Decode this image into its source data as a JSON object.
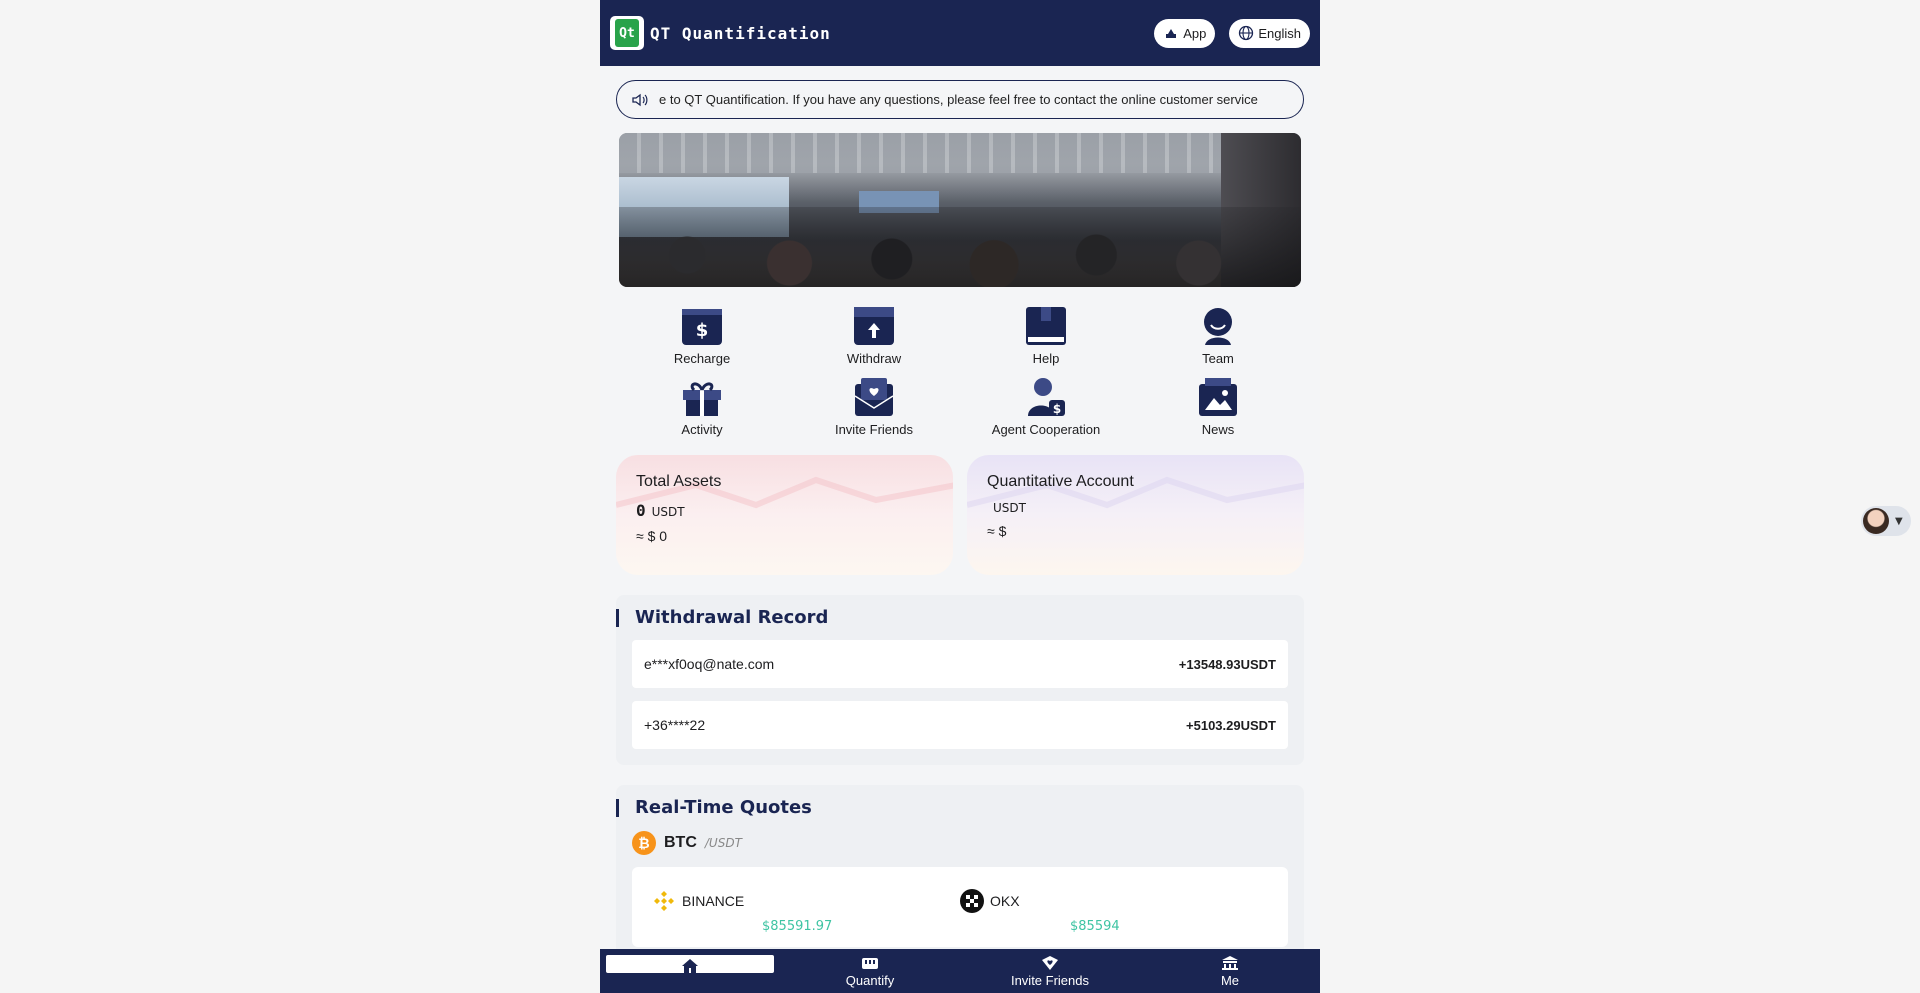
{
  "header": {
    "app_title": "QT Quantification",
    "logo_text": "Qt",
    "app_button": "App",
    "language_button": "English"
  },
  "notice": {
    "text": "e to QT Quantification. If you have any questions, please feel free to contact the online customer service"
  },
  "menu": {
    "items": [
      {
        "label": "Recharge",
        "icon": "recharge-icon"
      },
      {
        "label": "Withdraw",
        "icon": "withdraw-icon"
      },
      {
        "label": "Help",
        "icon": "help-book-icon"
      },
      {
        "label": "Team",
        "icon": "team-icon"
      },
      {
        "label": "Activity",
        "icon": "gift-icon"
      },
      {
        "label": "Invite Friends",
        "icon": "invite-icon"
      },
      {
        "label": "Agent Cooperation",
        "icon": "agent-icon"
      },
      {
        "label": "News",
        "icon": "news-icon"
      }
    ]
  },
  "assets": {
    "total": {
      "title": "Total Assets",
      "amount": "0",
      "unit": "USDT",
      "usd": "≈ $ 0"
    },
    "quant": {
      "title": "Quantitative Account",
      "amount": "",
      "unit": "USDT",
      "usd": "≈ $"
    }
  },
  "withdrawals": {
    "title": "Withdrawal Record",
    "rows": [
      {
        "user": "e***xf0oq@nate.com",
        "amount": "+13548.93USDT"
      },
      {
        "user": "+36****22",
        "amount": "+5103.29USDT"
      }
    ]
  },
  "quotes": {
    "title": "Real-Time Quotes",
    "symbol": "BTC",
    "quote": "/USDT",
    "coin_glyph": "₿",
    "exchanges": [
      {
        "name": "BINANCE",
        "price": "$85591.97"
      },
      {
        "name": "OKX",
        "price": "$85594"
      }
    ]
  },
  "bottom_nav": {
    "items": [
      {
        "label": "",
        "icon": "home-icon",
        "active": true
      },
      {
        "label": "Quantify",
        "icon": "quantify-icon"
      },
      {
        "label": "Invite Friends",
        "icon": "invite-heart-icon"
      },
      {
        "label": "Me",
        "icon": "bank-icon"
      }
    ]
  },
  "colors": {
    "primary": "#1a2552",
    "accent_green": "#3ec4a3",
    "btc_orange": "#f7931a",
    "binance_yellow": "#f0b90b"
  }
}
